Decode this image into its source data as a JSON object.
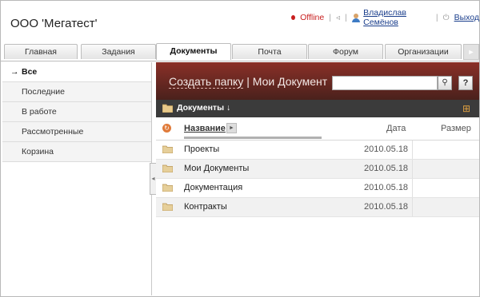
{
  "header": {
    "company": "ООО 'Мегатест'",
    "status": "Offline",
    "user": "Владислав Семёнов",
    "logout": "Выход"
  },
  "tabs": [
    "Главная",
    "Задания",
    "Документы",
    "Почта",
    "Форум",
    "Организации"
  ],
  "active_tab": "Документы",
  "sidebar": {
    "items": [
      {
        "label": "Все",
        "active": true
      },
      {
        "label": "Последние",
        "active": false
      },
      {
        "label": "В работе",
        "active": false
      },
      {
        "label": "Рассмотренные",
        "active": false
      },
      {
        "label": "Корзина",
        "active": false
      }
    ]
  },
  "folder_bar": {
    "create_folder": "Создать папку",
    "separator": "|",
    "my_documents": "Мои Документ",
    "search_value": "",
    "help": "?"
  },
  "docs_bar": {
    "label": "Документы"
  },
  "table": {
    "columns": {
      "name": "Название",
      "date": "Дата",
      "size": "Размер"
    },
    "rows": [
      {
        "name": "Проекты",
        "date": "2010.05.18",
        "size": ""
      },
      {
        "name": "Мои Документы",
        "date": "2010.05.18",
        "size": ""
      },
      {
        "name": "Документация",
        "date": "2010.05.18",
        "size": ""
      },
      {
        "name": "Контракты",
        "date": "2010.05.18",
        "size": ""
      }
    ]
  },
  "icons": {
    "status": "status-dot-icon",
    "volume": "speaker-icon",
    "user": "user-icon",
    "logout": "power-icon",
    "tabs_more": "tabs-more-icon",
    "search": "search-icon",
    "folder": "folder-icon",
    "tree": "tree-icon",
    "sort": "sort-icon",
    "collapse": "collapse-icon"
  },
  "colors": {
    "folder_bar_top": "#8a3028",
    "folder_bar_bottom": "#4a211c",
    "docs_bar": "#3b3b3b",
    "offline": "#c81e1e",
    "link": "#1a3e8c"
  }
}
